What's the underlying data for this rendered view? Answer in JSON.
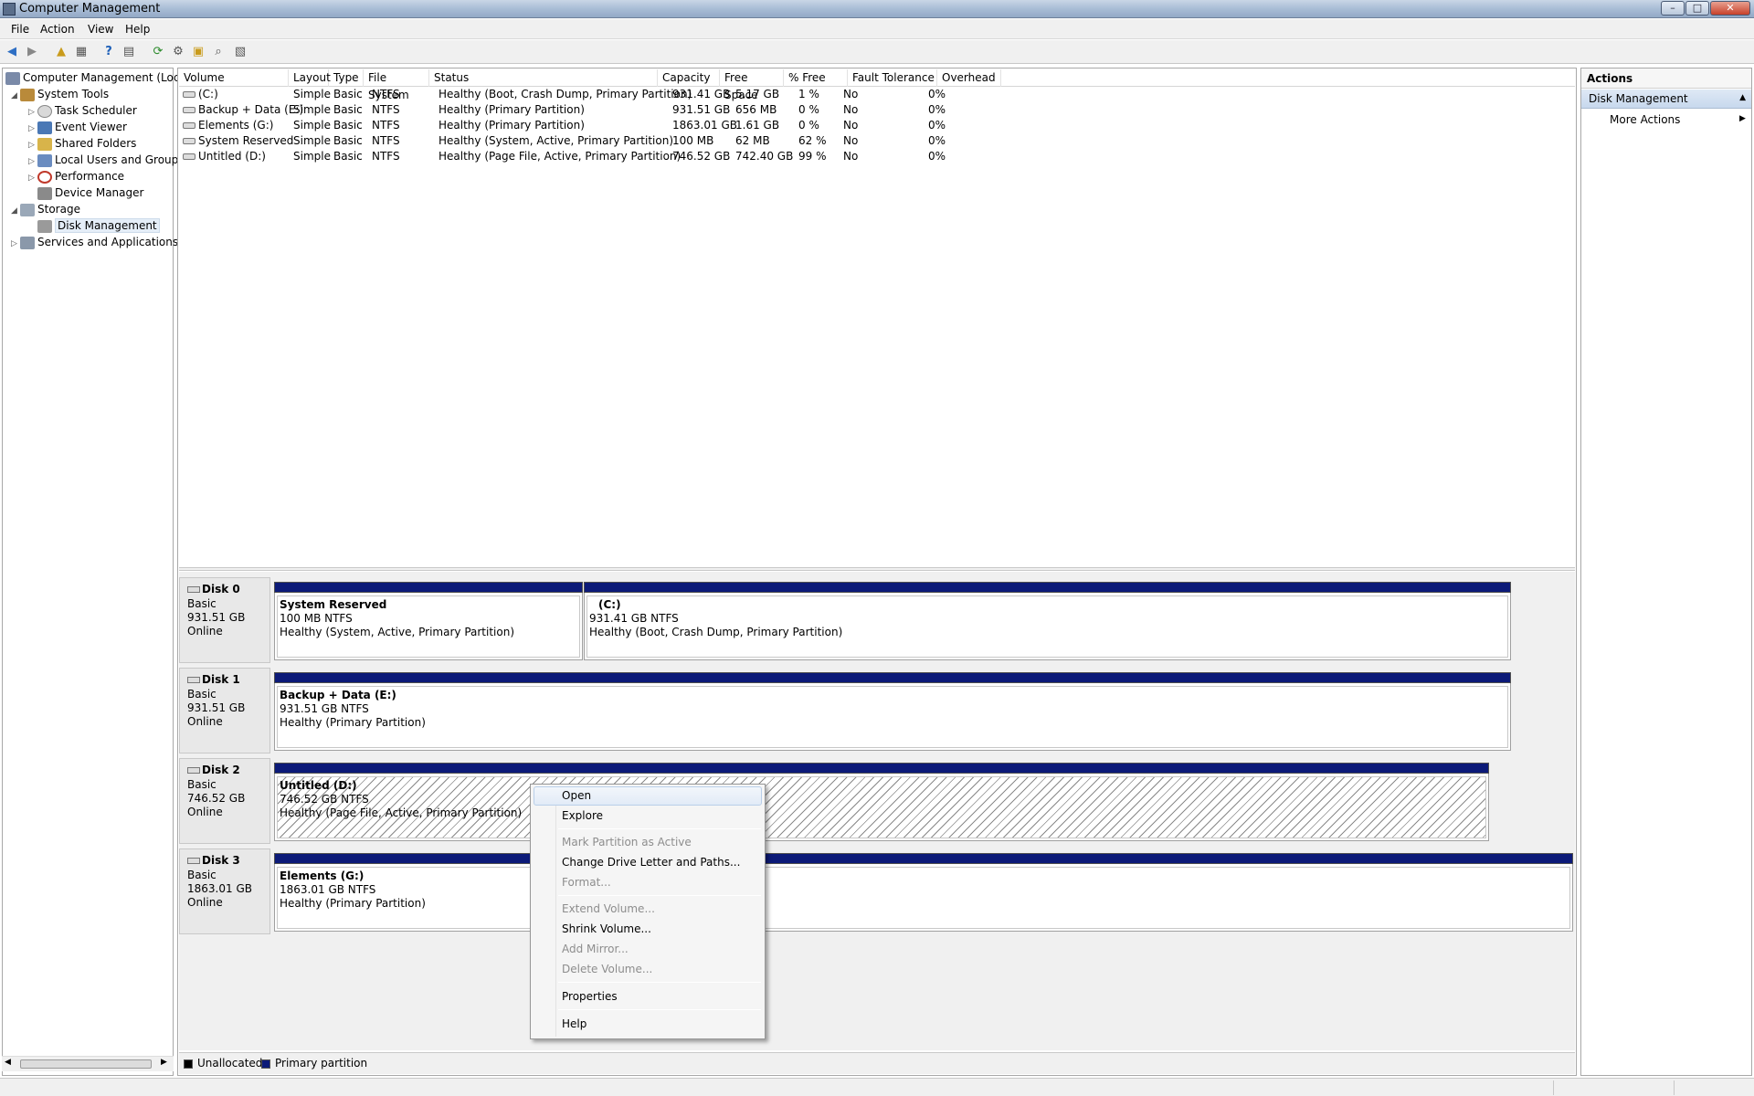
{
  "window": {
    "title": "Computer Management"
  },
  "menu": [
    "File",
    "Action",
    "View",
    "Help"
  ],
  "tree": {
    "items": [
      {
        "label": "Computer Management (Local",
        "icon": "computer-icon"
      },
      {
        "label": "System Tools",
        "icon": "tools-icon"
      },
      {
        "label": "Task Scheduler",
        "icon": "clock-icon"
      },
      {
        "label": "Event Viewer",
        "icon": "event-viewer-icon"
      },
      {
        "label": "Shared Folders",
        "icon": "shared-folder-icon"
      },
      {
        "label": "Local Users and Groups",
        "icon": "users-icon"
      },
      {
        "label": "Performance",
        "icon": "performance-icon"
      },
      {
        "label": "Device Manager",
        "icon": "device-manager-icon"
      },
      {
        "label": "Storage",
        "icon": "storage-icon"
      },
      {
        "label": "Disk Management",
        "icon": "disk-icon"
      },
      {
        "label": "Services and Applications",
        "icon": "services-icon"
      }
    ]
  },
  "volumes": {
    "columns": [
      "Volume",
      "Layout",
      "Type",
      "File System",
      "Status",
      "Capacity",
      "Free Space",
      "% Free",
      "Fault Tolerance",
      "Overhead"
    ],
    "rows": [
      [
        "(C:)",
        "Simple",
        "Basic",
        "NTFS",
        "Healthy (Boot, Crash Dump, Primary Partition)",
        "931.41 GB",
        "5.17 GB",
        "1 %",
        "No",
        "0%"
      ],
      [
        "Backup + Data (E:)",
        "Simple",
        "Basic",
        "NTFS",
        "Healthy (Primary Partition)",
        "931.51 GB",
        "656 MB",
        "0 %",
        "No",
        "0%"
      ],
      [
        "Elements (G:)",
        "Simple",
        "Basic",
        "NTFS",
        "Healthy (Primary Partition)",
        "1863.01 GB",
        "1.61 GB",
        "0 %",
        "No",
        "0%"
      ],
      [
        "System Reserved",
        "Simple",
        "Basic",
        "NTFS",
        "Healthy (System, Active, Primary Partition)",
        "100 MB",
        "62 MB",
        "62 %",
        "No",
        "0%"
      ],
      [
        "Untitled (D:)",
        "Simple",
        "Basic",
        "NTFS",
        "Healthy (Page File, Active, Primary Partition)",
        "746.52 GB",
        "742.40 GB",
        "99 %",
        "No",
        "0%"
      ]
    ]
  },
  "disks": [
    {
      "name": "Disk 0",
      "type": "Basic",
      "size": "931.51 GB",
      "status": "Online",
      "partitions": [
        {
          "name": "System Reserved",
          "size": "100 MB NTFS",
          "status": "Healthy (System, Active, Primary Partition)"
        },
        {
          "name": "(C:)",
          "size": "931.41 GB NTFS",
          "status": "Healthy (Boot, Crash Dump, Primary Partition)"
        }
      ]
    },
    {
      "name": "Disk 1",
      "type": "Basic",
      "size": "931.51 GB",
      "status": "Online",
      "partitions": [
        {
          "name": "Backup + Data  (E:)",
          "size": "931.51 GB NTFS",
          "status": "Healthy (Primary Partition)"
        }
      ]
    },
    {
      "name": "Disk 2",
      "type": "Basic",
      "size": "746.52 GB",
      "status": "Online",
      "partitions": [
        {
          "name": "Untitled  (D:)",
          "size": "746.52 GB NTFS",
          "status": "Healthy (Page File, Active, Primary Partition)"
        }
      ]
    },
    {
      "name": "Disk 3",
      "type": "Basic",
      "size": "1863.01 GB",
      "status": "Online",
      "partitions": [
        {
          "name": "Elements  (G:)",
          "size": "1863.01 GB NTFS",
          "status": "Healthy (Primary Partition)"
        }
      ]
    }
  ],
  "legend": [
    {
      "label": "Unallocated",
      "color": "#000000"
    },
    {
      "label": "Primary partition",
      "color": "#0c1a78"
    }
  ],
  "actions": {
    "title": "Actions",
    "section": "Disk Management",
    "more": "More Actions"
  },
  "context_menu": {
    "items": [
      {
        "label": "Open",
        "enabled": true,
        "highlighted": true
      },
      {
        "label": "Explore",
        "enabled": true
      },
      {
        "label": "Mark Partition as Active",
        "enabled": false
      },
      {
        "label": "Change Drive Letter and Paths...",
        "enabled": true
      },
      {
        "label": "Format...",
        "enabled": false
      },
      {
        "label": "Extend Volume...",
        "enabled": false
      },
      {
        "label": "Shrink Volume...",
        "enabled": true
      },
      {
        "label": "Add Mirror...",
        "enabled": false
      },
      {
        "label": "Delete Volume...",
        "enabled": false
      },
      {
        "label": "Properties",
        "enabled": true
      },
      {
        "label": "Help",
        "enabled": true
      }
    ]
  },
  "colors": {
    "partition_bar": "#0c1a78",
    "titlebar": "#a9bdd6"
  }
}
